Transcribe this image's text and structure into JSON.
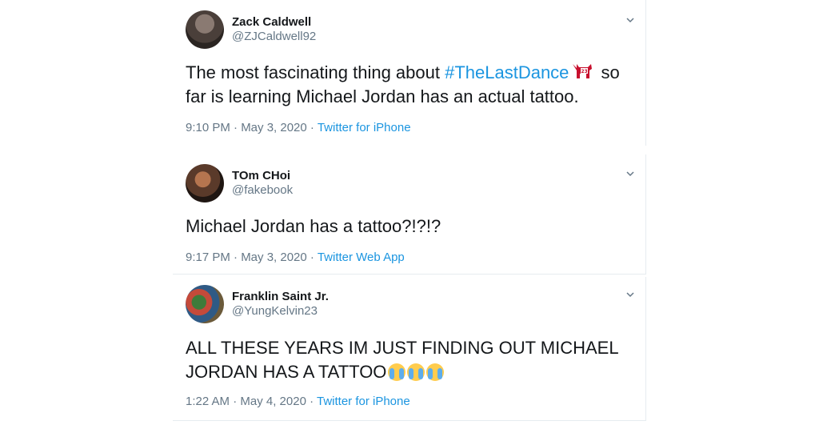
{
  "tweets": [
    {
      "name": "Zack Caldwell",
      "handle": "@ZJCaldwell92",
      "text_before": "The most fascinating thing about ",
      "hashtag": "#TheLastDance",
      "text_after": " so far is learning Michael Jordan has an actual tattoo.",
      "hashtag_icon": "goat-23-icon",
      "time": "9:10 PM · May 3, 2020 · ",
      "source": "Twitter for iPhone"
    },
    {
      "name": "TOm CHoi",
      "handle": "@fakebook",
      "text": "Michael Jordan has a tattoo?!?!?",
      "time": "9:17 PM · May 3, 2020 · ",
      "source": "Twitter Web App"
    },
    {
      "name": "Franklin Saint Jr.",
      "handle": "@YungKelvin23",
      "text": "ALL THESE YEARS IM JUST FINDING OUT MICHAEL JORDAN HAS A TATTOO",
      "emoji": "loudly-crying-face-icon",
      "time": "1:22 AM · May 4, 2020 · ",
      "source": "Twitter for iPhone"
    }
  ],
  "colors": {
    "link": "#1b95e0",
    "secondary_text": "#657786",
    "primary_text": "#14171a",
    "divider": "#e6ecf0"
  }
}
